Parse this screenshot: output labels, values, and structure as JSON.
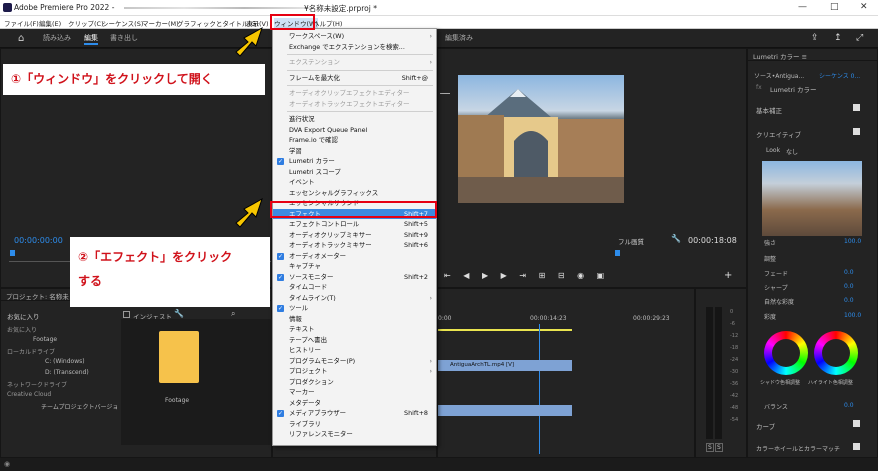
{
  "app": {
    "title": "Adobe Premiere Pro 2022 - ",
    "project_file": "¥名称未設定.prproj *"
  },
  "window_controls": {
    "minimize": "—",
    "maximize": "□",
    "close": "✕"
  },
  "menubar": [
    "ファイル(F)",
    "編集(E)",
    "クリップ(C)",
    "シーケンス(S)",
    "マーカー(M)",
    "グラフィックとタイトル(G)",
    "表示(V)",
    "ウィンドウ(W)",
    "ヘルプ(H)"
  ],
  "workspace_tabs": [
    "読み込み",
    "編集",
    "書き出し"
  ],
  "program_header": "編集済み",
  "window_menu": {
    "items": [
      {
        "label": "ワークスペース(W)",
        "arrow": true
      },
      {
        "label": "Exchange でエクステンションを検索..."
      },
      {
        "sep": true
      },
      {
        "label": "エクステンション",
        "arrow": true,
        "disabled": true
      },
      {
        "sep": true
      },
      {
        "label": "フレームを最大化",
        "shortcut": "Shift+@"
      },
      {
        "sep": true
      },
      {
        "label": "オーディオクリップエフェクトエディター",
        "disabled": true
      },
      {
        "label": "オーディオトラックエフェクトエディター",
        "disabled": true
      },
      {
        "sep": true
      },
      {
        "label": "進行状況"
      },
      {
        "label": "DVA Export Queue Panel"
      },
      {
        "label": "Frame.io で確認"
      },
      {
        "label": "学習"
      },
      {
        "label": "Lumetri カラー",
        "checked": true
      },
      {
        "label": "Lumetri スコープ"
      },
      {
        "label": "イベント"
      },
      {
        "label": "エッセンシャルグラフィックス"
      },
      {
        "label": "エッセンシャルサウンド"
      },
      {
        "label": "エフェクト",
        "shortcut": "Shift+7",
        "highlight": true
      },
      {
        "label": "エフェクトコントロール",
        "shortcut": "Shift+5"
      },
      {
        "label": "オーディオクリップミキサー",
        "shortcut": "Shift+9"
      },
      {
        "label": "オーディオトラックミキサー",
        "shortcut": "Shift+6"
      },
      {
        "label": "オーディオメーター",
        "checked": true
      },
      {
        "label": "キャプチャ"
      },
      {
        "label": "ソースモニター",
        "shortcut": "Shift+2",
        "checked": true
      },
      {
        "label": "タイムコード"
      },
      {
        "label": "タイムライン(T)",
        "arrow": true
      },
      {
        "label": "ツール",
        "checked": true
      },
      {
        "label": "情報"
      },
      {
        "label": "テキスト"
      },
      {
        "label": "テープへ書出"
      },
      {
        "label": "ヒストリー"
      },
      {
        "label": "プログラムモニター(P)",
        "arrow": true
      },
      {
        "label": "プロジェクト",
        "arrow": true
      },
      {
        "label": "プロダクション"
      },
      {
        "label": "マーカー"
      },
      {
        "label": "メタデータ"
      },
      {
        "label": "メディアブラウザー",
        "shortcut": "Shift+8",
        "checked": true
      },
      {
        "label": "ライブラリ"
      },
      {
        "label": "リファレンスモニター"
      }
    ]
  },
  "callouts": {
    "step1": "①「ウィンドウ」をクリックして開く",
    "step2_line1": "②「エフェクト」をクリック",
    "step2_line2": "する"
  },
  "source_monitor": {
    "timecode": "00:00:00:00"
  },
  "program_monitor": {
    "fit": "フル画質",
    "duration": "00:00:18:08"
  },
  "project_panel": {
    "title": "プロジェクト: 名称未",
    "search_label": "お気に入り",
    "ingest": "インジェスト",
    "tree": [
      {
        "label": "お気に入り",
        "level": 0
      },
      {
        "label": "Footage",
        "level": 1
      },
      {
        "label": "ローカルドライブ",
        "level": 0
      },
      {
        "label": "C: (Windows)",
        "level": 1
      },
      {
        "label": "D: (Transcend)",
        "level": 1
      },
      {
        "label": "ネットワークドライブ",
        "level": 0
      },
      {
        "label": "Creative Cloud",
        "level": 0
      },
      {
        "label": "チームプロジェクトバージョ",
        "level": 1
      }
    ],
    "folder_label": "Footage"
  },
  "timeline": {
    "ruler": [
      "0:00",
      "00:00:14:23",
      "00:00:29:23"
    ],
    "clip_name": "AntiguaArchTL.mp4 [V]"
  },
  "audio_meter": {
    "ticks": [
      "0",
      "-6",
      "-12",
      "-18",
      "-24",
      "-30",
      "-36",
      "-42",
      "-48",
      "-54"
    ],
    "solo": "S"
  },
  "lumetri": {
    "tab": "Lumetri カラー",
    "source_row": "ソース•Antigua...",
    "sequence_row": "シーケンス 0...",
    "fx_label": "fx",
    "fx_name": "Lumetri カラー",
    "basic": "基本補正",
    "creative": "クリエイティブ",
    "look_label": "Look",
    "look_value": "なし",
    "intensity_label": "強さ",
    "intensity_value": "100.0",
    "adjust": "調整",
    "sliders": [
      {
        "label": "フェード",
        "value": "0.0"
      },
      {
        "label": "シャープ",
        "value": "0.0"
      },
      {
        "label": "自然な彩度",
        "value": "0.0"
      },
      {
        "label": "彩度",
        "value": "100.0"
      }
    ],
    "wheels_label1": "シャドウ色相調整",
    "wheels_label2": "ハイライト色相調整",
    "balance_label": "バランス",
    "balance_value": "0.0",
    "curves": "カーブ",
    "wheels_match": "カラーホイールとカラーマッチ"
  },
  "colors": {
    "accent": "#2d8ceb",
    "highlight": "#3c8ae0",
    "callout_red": "#d0121b",
    "arrow_yellow": "#f7c600"
  }
}
